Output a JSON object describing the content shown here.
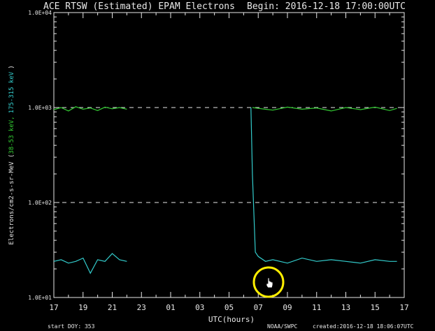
{
  "chart_data": {
    "type": "line",
    "title": "ACE RTSW (Estimated) EPAM Electrons",
    "begin_label": "Begin: 2016-12-18 17:00:00UTC",
    "xlabel": "UTC(hours)",
    "ylabel": {
      "prefix": "Electrons/cm2-s-sr-MeV  (",
      "series1": "38-53 keV,",
      "series2": "175-315 keV",
      "suffix": ")"
    },
    "yscale": "log",
    "ylim": [
      10,
      10000
    ],
    "ytick_labels": [
      "1.0E+01",
      "1.0E+02",
      "1.0E+03",
      "1.0E+04"
    ],
    "xtick_labels": [
      "17",
      "19",
      "21",
      "23",
      "01",
      "03",
      "05",
      "07",
      "09",
      "11",
      "13",
      "15",
      "17"
    ],
    "xlim_hours_since_17utc": [
      0,
      24
    ],
    "reference_lines": [
      100,
      1000
    ],
    "series": [
      {
        "name": "38-53 keV",
        "color": "#33cc33",
        "segments": [
          {
            "x": [
              0,
              0.5,
              1,
              1.5,
              2,
              2.5,
              3,
              3.5,
              4,
              4.5,
              5
            ],
            "y": [
              950,
              1000,
              920,
              1020,
              960,
              990,
              930,
              1010,
              970,
              1000,
              960
            ]
          },
          {
            "x": [
              13.6,
              14,
              15,
              16,
              17,
              18,
              19,
              20,
              21,
              22,
              23,
              23.5
            ],
            "y": [
              1000,
              980,
              940,
              1010,
              960,
              990,
              920,
              1000,
              950,
              1010,
              930,
              980
            ]
          }
        ]
      },
      {
        "name": "175-315 keV",
        "color": "#33cccc",
        "segments": [
          {
            "x": [
              0,
              0.5,
              1,
              1.5,
              2,
              2.5,
              3,
              3.5,
              4,
              4.5,
              5
            ],
            "y": [
              24,
              25,
              23,
              24,
              26,
              18,
              25,
              24,
              29,
              25,
              24
            ]
          },
          {
            "x": [
              13.5,
              13.6,
              13.8,
              14,
              14.5,
              15,
              16,
              17,
              18,
              19,
              20,
              21,
              22,
              23,
              23.5
            ],
            "y": [
              1000,
              200,
              30,
              27,
              24,
              25,
              23,
              26,
              24,
              25,
              24,
              23,
              25,
              24,
              24
            ]
          }
        ]
      }
    ],
    "footer": {
      "start_doy": "start DOY:  353",
      "source": "NOAA/SWPC",
      "created": "created:2016-12-18 18:06:07UTC"
    },
    "grid": false
  },
  "colors": {
    "background": "#000000",
    "axes": "#e8e8e8",
    "series1": "#33cc33",
    "series2": "#33cccc",
    "cursor_ring": "#ffee00"
  },
  "cursor_icon": "hand-pointer-icon"
}
